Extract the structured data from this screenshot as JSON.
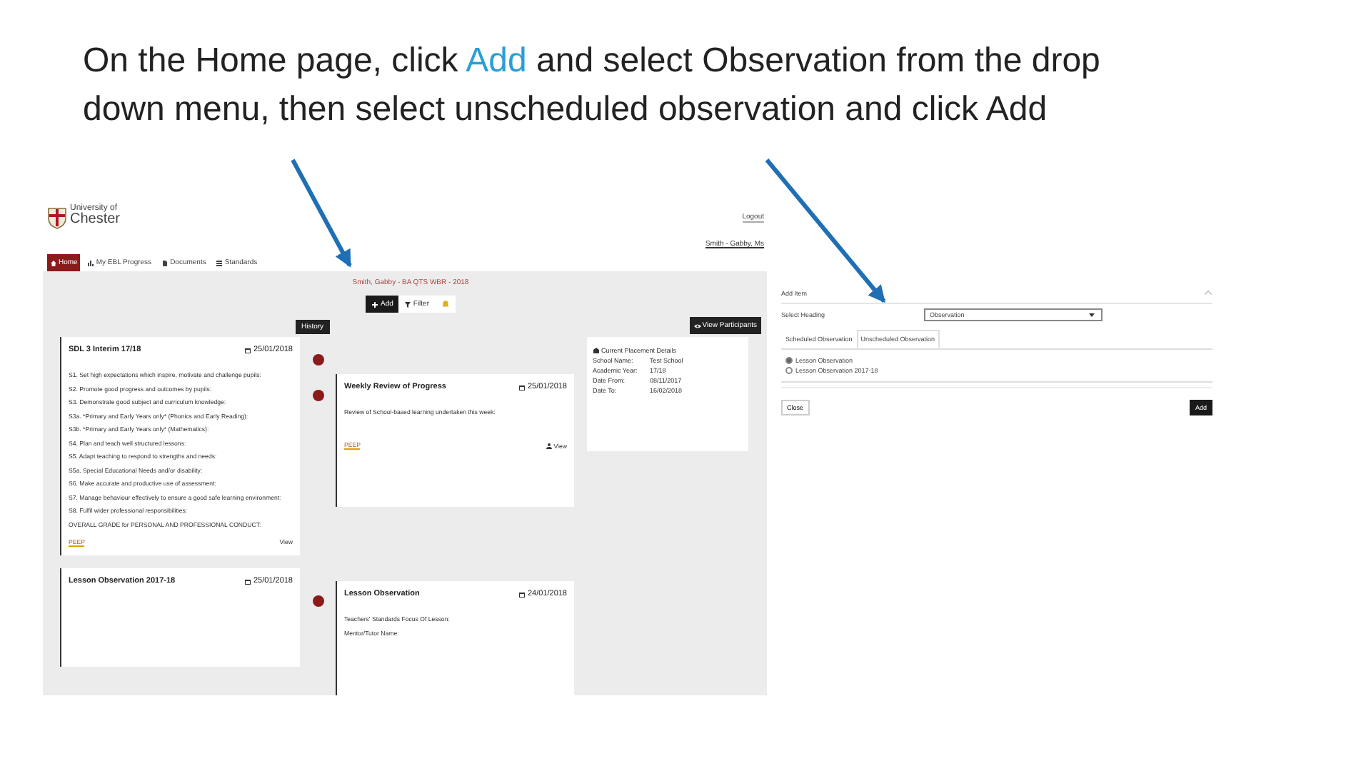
{
  "title": {
    "segments": [
      {
        "text": "On the Home page, click ",
        "highlight": false
      },
      {
        "text": "Add",
        "highlight": true
      },
      {
        "text": " and select Observation from the drop down menu, then select unscheduled observation and click Add",
        "highlight": false
      }
    ]
  },
  "app": {
    "logo": {
      "line1": "University of",
      "line2": "Chester"
    },
    "logout": "Logout",
    "user": "Smith - Gabby, Ms",
    "nav": [
      {
        "kind": "home",
        "label": "Home",
        "selected": true
      },
      {
        "kind": "chart",
        "label": "My EBL Progress",
        "selected": false
      },
      {
        "kind": "doc",
        "label": "Documents",
        "selected": false
      },
      {
        "kind": "list",
        "label": "Standards",
        "selected": false
      }
    ],
    "student_line": "Smith, Gabby - BA QTS WBR - 2018",
    "toolbar": [
      {
        "kind": "add",
        "label": "Add"
      },
      {
        "kind": "filter",
        "label": "Filter"
      },
      {
        "kind": "bell"
      }
    ],
    "history": "History",
    "view_participants": "View Participants",
    "left_cards": [
      {
        "title": "SDL 3 Interim 17/18",
        "date": "25/01/2018",
        "lines": [
          "S1. Set high expectations which inspire, motivate and challenge pupils:",
          "S2. Promote good progress and outcomes by pupils:",
          "S3. Demonstrate good subject and curriculum knowledge:",
          "S3a. *Primary and Early Years only* (Phonics and Early Reading):",
          "S3b. *Primary and Early Years only* (Mathematics):",
          "S4. Plan and teach well structured lessons:",
          "S5. Adapt teaching to respond to strengths and needs:",
          "S5a. Special Educational Needs and/or disability:",
          "S6. Make accurate and productive use of assessment:",
          "S7. Manage behaviour effectively to ensure a good safe learning environment:",
          "S8. Fulfil wider professional responsibilities:",
          "OVERALL GRADE for PERSONAL AND PROFESSIONAL CONDUCT:"
        ],
        "footer_link": "PEEP",
        "footer_action": "View"
      },
      {
        "title": "Lesson Observation 2017-18",
        "date": "25/01/2018"
      }
    ],
    "right_cards": [
      {
        "title": "Weekly Review of Progress",
        "date": "25/01/2018",
        "lines": [
          "Review of School-based learning undertaken this week:"
        ],
        "footer_link": "PEEP",
        "footer_action": "View"
      },
      {
        "title": "Lesson Observation",
        "date": "24/01/2018",
        "lines": [
          "Teachers' Standards Focus Of Lesson:",
          "Mentor/Tutor Name:"
        ]
      }
    ],
    "placement": {
      "heading": "Current Placement Details",
      "rows": [
        {
          "label": "School Name:",
          "value": "Test School"
        },
        {
          "label": "Academic Year:",
          "value": "17/18"
        },
        {
          "label": "Date From:",
          "value": "08/11/2017"
        },
        {
          "label": "Date To:",
          "value": "16/02/2018"
        }
      ]
    }
  },
  "modal": {
    "title": "Add Item",
    "heading_label": "Select Heading",
    "heading_value": "Observation",
    "tabs": [
      {
        "label": "Scheduled Observation",
        "selected": false
      },
      {
        "label": "Unscheduled Observation",
        "selected": true
      }
    ],
    "options": [
      {
        "label": "Lesson Observation",
        "selected": true
      },
      {
        "label": "Lesson Observation 2017-18",
        "selected": false
      }
    ],
    "close": "Close",
    "add": "Add"
  }
}
